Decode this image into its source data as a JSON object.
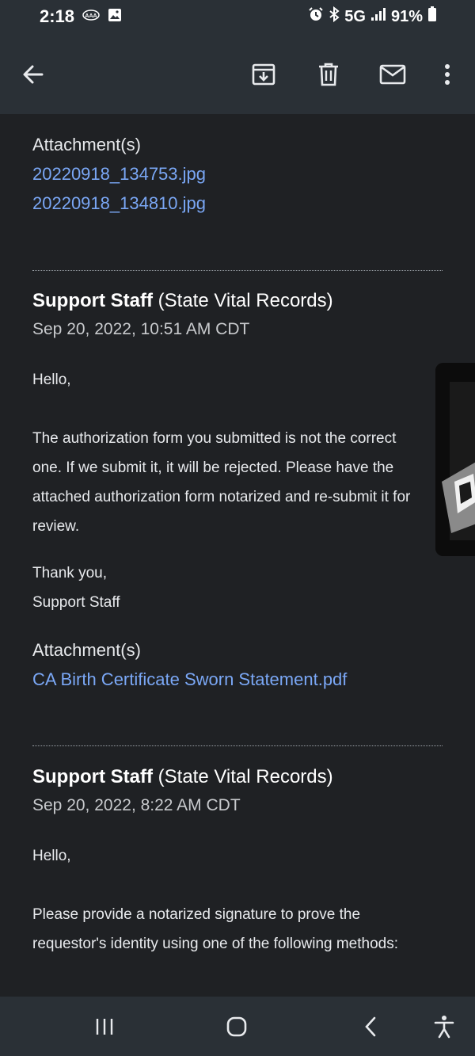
{
  "status_bar": {
    "time": "2:18",
    "network": "5G",
    "battery": "91%"
  },
  "toolbar": {
    "icons": [
      "back-arrow-icon",
      "archive-icon",
      "delete-icon",
      "mark-unread-icon",
      "more-vert-icon"
    ]
  },
  "messages": [
    {
      "attachments_title": "Attachment(s)",
      "attachments": [
        "20220918_134753.jpg",
        "20220918_134810.jpg"
      ]
    },
    {
      "sender_name": "Support Staff",
      "sender_org": "(State Vital Records)",
      "date": "Sep 20, 2022, 10:51 AM CDT",
      "greeting": "Hello,",
      "body_lines": [
        "The authorization form you submitted is not the correct",
        "one. If we submit it, it will be rejected. Please have the",
        "attached authorization form notarized and re-submit it for",
        "review."
      ],
      "closing": "Thank you,",
      "signature": "Support Staff",
      "attachments_title": "Attachment(s)",
      "attachments": [
        "CA Birth Certificate Sworn Statement.pdf"
      ]
    },
    {
      "sender_name": "Support Staff",
      "sender_org": "(State Vital Records)",
      "date": "Sep 20, 2022, 8:22 AM CDT",
      "greeting": "Hello,",
      "body_lines": [
        "Please provide a notarized signature to prove the",
        "requestor's identity using one of the following methods:"
      ]
    }
  ],
  "nav_bar": {
    "icons": [
      "recents-icon",
      "home-icon",
      "back-icon",
      "accessibility-icon"
    ]
  }
}
